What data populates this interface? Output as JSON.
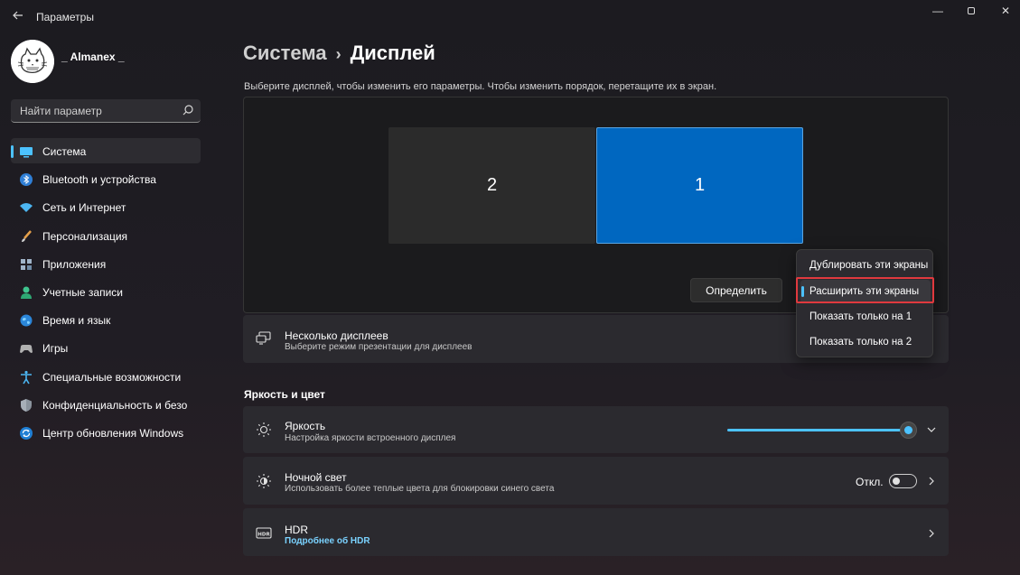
{
  "window": {
    "title": "Параметры",
    "controls": {
      "minimize": "—",
      "close": "✕"
    }
  },
  "user": {
    "name": "_ Almanex _"
  },
  "search": {
    "placeholder": "Найти параметр"
  },
  "sidebar": {
    "items": [
      {
        "label": "Система",
        "icon": "system-icon",
        "active": true
      },
      {
        "label": "Bluetooth и устройства",
        "icon": "bluetooth-icon"
      },
      {
        "label": "Сеть и Интернет",
        "icon": "wifi-icon"
      },
      {
        "label": "Персонализация",
        "icon": "brush-icon"
      },
      {
        "label": "Приложения",
        "icon": "apps-icon"
      },
      {
        "label": "Учетные записи",
        "icon": "account-icon"
      },
      {
        "label": "Время и язык",
        "icon": "globe-icon"
      },
      {
        "label": "Игры",
        "icon": "gamepad-icon"
      },
      {
        "label": "Специальные возможности",
        "icon": "accessibility-icon"
      },
      {
        "label": "Конфиденциальность и безопасность",
        "icon": "shield-icon"
      },
      {
        "label": "Центр обновления Windows",
        "icon": "update-icon"
      }
    ]
  },
  "breadcrumb": {
    "parent": "Система",
    "separator": "›",
    "current": "Дисплей"
  },
  "instructions": "Выберите дисплей, чтобы изменить его параметры. Чтобы изменить порядок, перетащите их в экран.",
  "monitors": {
    "secondary": "2",
    "primary": "1"
  },
  "identify_button": "Определить",
  "multi_display": {
    "title": "Несколько дисплеев",
    "subtitle": "Выберите режим презентации для дисплеев"
  },
  "projection_menu": {
    "items": [
      {
        "label": "Дублировать эти экраны"
      },
      {
        "label": "Расширить эти экраны",
        "selected": true
      },
      {
        "label": "Показать только на 1"
      },
      {
        "label": "Показать только на 2"
      }
    ]
  },
  "section_brightness": "Яркость и цвет",
  "brightness": {
    "title": "Яркость",
    "subtitle": "Настройка яркости встроенного дисплея",
    "level": 1.0
  },
  "night_light": {
    "title": "Ночной свет",
    "subtitle": "Использовать более теплые цвета для блокировки синего света",
    "state": "Откл."
  },
  "hdr": {
    "title": "HDR",
    "link": "Подробнее об HDR"
  },
  "colors": {
    "accent": "#4cc2ff",
    "primary_monitor": "#0067c0",
    "highlight": "#e0393e"
  }
}
